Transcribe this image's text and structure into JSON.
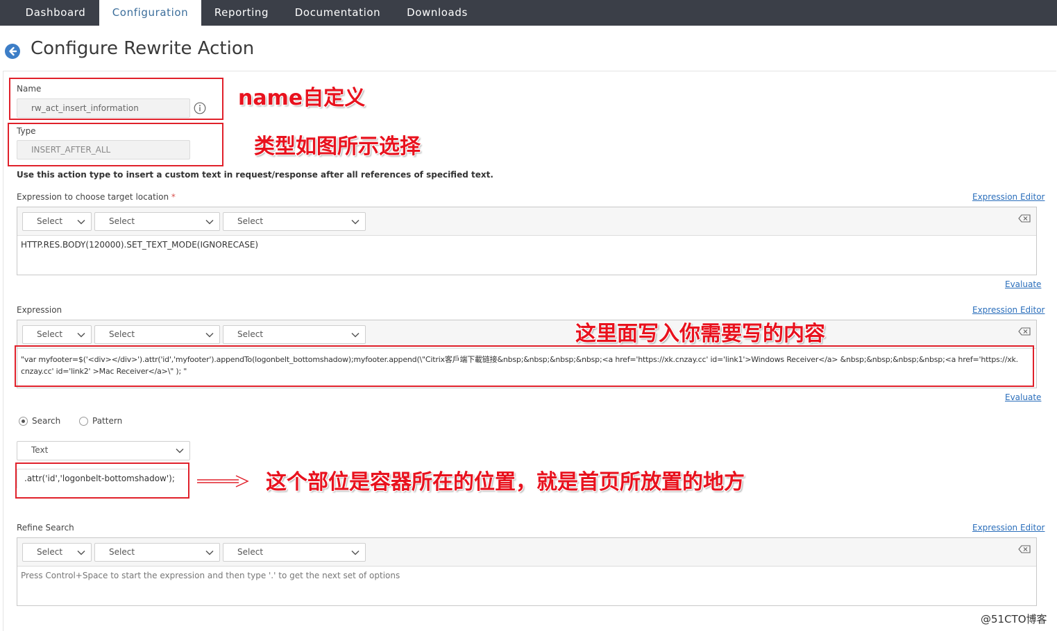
{
  "nav": {
    "tabs": [
      {
        "label": "Dashboard"
      },
      {
        "label": "Configuration"
      },
      {
        "label": "Reporting"
      },
      {
        "label": "Documentation"
      },
      {
        "label": "Downloads"
      }
    ]
  },
  "page": {
    "title": "Configure Rewrite Action"
  },
  "form": {
    "name_label": "Name",
    "name_value": "rw_act_insert_information",
    "type_label": "Type",
    "type_value": "INSERT_AFTER_ALL",
    "type_hint": "Use this action type to insert a custom text in request/response after all references of specified text.",
    "target": {
      "label": "Expression to choose target location",
      "required_mark": "*",
      "editor_link": "Expression Editor",
      "selects": [
        "Select",
        "Select",
        "Select"
      ],
      "value": "HTTP.RES.BODY(120000).SET_TEXT_MODE(IGNORECASE)",
      "evaluate_link": "Evaluate"
    },
    "expression": {
      "label": "Expression",
      "editor_link": "Expression Editor",
      "selects": [
        "Select",
        "Select",
        "Select"
      ],
      "value_line1": "\"var myfooter=$('<div></div>').attr('id','myfooter').appendTo(logonbelt_bottomshadow);myfooter.append(\\\"Citrix客戶端下載链接&nbsp;&nbsp;&nbsp;&nbsp;<a href='https://xk.cnzay.cc' id='link1'>Windows Receiver</a> &nbsp;&nbsp;&nbsp;&nbsp;<a href='https://xk.",
      "value_line2": "cnzay.cc' id='link2' >Mac Receiver</a>\\\" ); \"",
      "evaluate_link": "Evaluate"
    },
    "search_mode": {
      "search_label": "Search",
      "pattern_label": "Pattern",
      "selected": "Search"
    },
    "text_select": "Text",
    "search_text": ".attr('id','logonbelt-bottomshadow');",
    "refine": {
      "label": "Refine Search",
      "editor_link": "Expression Editor",
      "selects": [
        "Select",
        "Select",
        "Select"
      ],
      "placeholder": "Press Control+Space to start the expression and then type '.' to get the next set of options"
    }
  },
  "annotations": {
    "name_note": "name自定义",
    "type_note": "类型如图所示选择",
    "expression_note": "这里面写入你需要写的内容",
    "container_note": "这个部位是容器所在的位置，就是首页所放置的地方"
  },
  "watermark": "@51CTO博客",
  "colors": {
    "nav_bg": "#3b3f48",
    "accent": "#3d7ec7",
    "annotation_red": "#e8121e",
    "link": "#2a6ebb"
  },
  "icons": {
    "back": "back-arrow-icon",
    "info": "info-icon",
    "chevron": "chevron-down-icon",
    "clear": "backspace-clear-icon",
    "arrow": "right-arrow-icon"
  }
}
